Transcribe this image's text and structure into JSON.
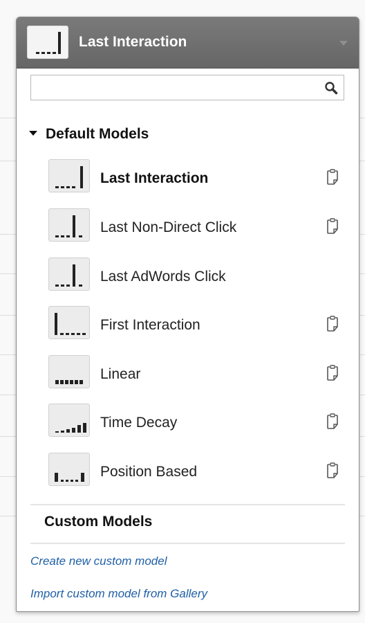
{
  "header": {
    "selected_model": "Last Interaction",
    "thumbnail": "last-interaction-chart-icon"
  },
  "search": {
    "value": "",
    "placeholder": "",
    "icon": "search-icon"
  },
  "default_models": {
    "label": "Default Models",
    "expanded": true,
    "items": [
      {
        "label": "Last Interaction",
        "selected": true,
        "copy_icon": true,
        "icon": "last-interaction-chart-icon"
      },
      {
        "label": "Last Non-Direct Click",
        "selected": false,
        "copy_icon": true,
        "icon": "last-non-direct-click-chart-icon"
      },
      {
        "label": "Last AdWords Click",
        "selected": false,
        "copy_icon": false,
        "icon": "last-adwords-click-chart-icon"
      },
      {
        "label": "First Interaction",
        "selected": false,
        "copy_icon": true,
        "icon": "first-interaction-chart-icon"
      },
      {
        "label": "Linear",
        "selected": false,
        "copy_icon": true,
        "icon": "linear-chart-icon"
      },
      {
        "label": "Time Decay",
        "selected": false,
        "copy_icon": true,
        "icon": "time-decay-chart-icon"
      },
      {
        "label": "Position Based",
        "selected": false,
        "copy_icon": true,
        "icon": "position-based-chart-icon"
      }
    ]
  },
  "custom_models": {
    "label": "Custom Models"
  },
  "links": {
    "create": "Create new custom model",
    "import": "Import custom model from Gallery"
  },
  "colors": {
    "header_bg": "#6f6f6f",
    "link": "#1f5fa6",
    "thumb_bg": "#ececec",
    "bar": "#222222"
  }
}
